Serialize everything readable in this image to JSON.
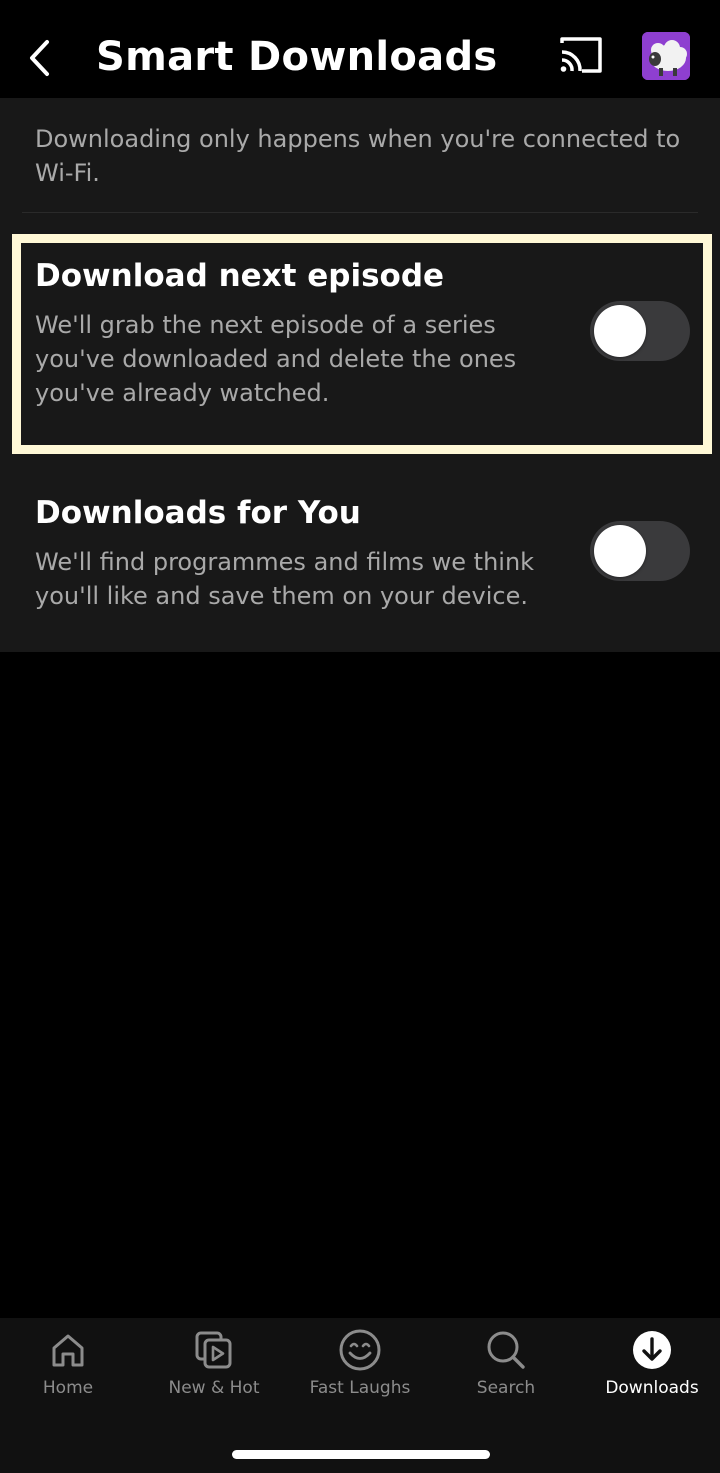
{
  "header": {
    "title": "Smart Downloads",
    "back_icon": "chevron-left-icon",
    "cast_icon": "cast-icon",
    "avatar_icon": "sheep-avatar"
  },
  "intro": "Downloading only happens when you're connected to Wi-Fi.",
  "settings": [
    {
      "title": "Download next episode",
      "description": "We'll grab the next episode of a series you've downloaded and delete the ones you've already watched.",
      "enabled": false,
      "highlighted": true
    },
    {
      "title": "Downloads for You",
      "description": "We'll find programmes and films we think you'll like and save them on your device.",
      "enabled": false,
      "highlighted": false
    }
  ],
  "bottom_nav": {
    "items": [
      {
        "label": "Home",
        "icon": "home-icon",
        "active": false
      },
      {
        "label": "New & Hot",
        "icon": "new-hot-icon",
        "active": false
      },
      {
        "label": "Fast Laughs",
        "icon": "smiley-icon",
        "active": false
      },
      {
        "label": "Search",
        "icon": "search-icon",
        "active": false
      },
      {
        "label": "Downloads",
        "icon": "download-icon",
        "active": true
      }
    ]
  },
  "colors": {
    "background": "#000000",
    "panel": "#181818",
    "highlight_border": "#fff8d6",
    "toggle_off": "#3a3a3c",
    "secondary_text": "#a9a9a9",
    "avatar_bg": "#8e3fd0"
  }
}
